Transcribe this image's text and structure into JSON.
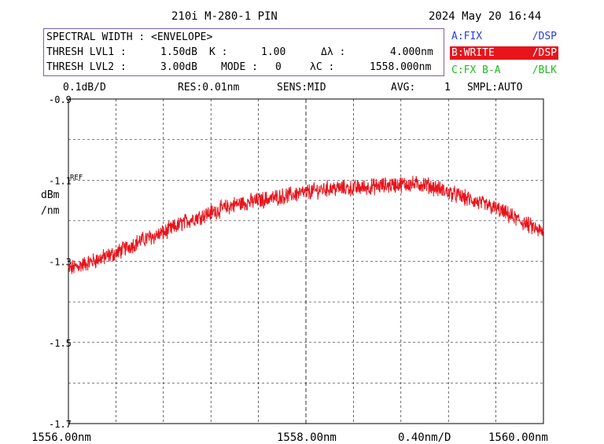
{
  "header": {
    "title": "210i M-280-1 PIN",
    "datetime": "2024 May 20 16:44"
  },
  "params": {
    "line1_label": "SPECTRAL WIDTH : <ENVELOPE>",
    "thresh1_label": "THRESH LVL1 :",
    "thresh1_value": "1.50dB",
    "k_label": "K :",
    "k_value": "1.00",
    "dlambda_label": "Δλ :",
    "dlambda_value": "4.000nm",
    "thresh2_label": "THRESH LVL2 :",
    "thresh2_value": "3.00dB",
    "mode_label": "MODE :",
    "mode_value": "0",
    "lambdac_label": "λC :",
    "lambdac_value": "1558.000nm"
  },
  "traces": [
    {
      "left": "A:FIX",
      "right": "/DSP",
      "color": "#2a3fd0",
      "bg": "#ffffff"
    },
    {
      "left": "B:WRITE",
      "right": "/DSP",
      "color": "#ffffff",
      "bg": "#e8141c"
    },
    {
      "left": "C:FX B-A",
      "right": "/BLK",
      "color": "#22bb22",
      "bg": "#ffffff"
    }
  ],
  "status": {
    "scale": "0.1dB/D",
    "res": "RES:0.01nm",
    "sens": "SENS:MID",
    "avg_label": "AVG:",
    "avg_value": "1",
    "smpl": "SMPL:AUTO"
  },
  "chart_data": {
    "type": "line",
    "ylim": [
      -1.7,
      -0.9
    ],
    "xlim": [
      1556.0,
      1560.0
    ],
    "y_ticks": [
      "-0.9",
      "-1.1",
      "-1.3",
      "-1.5",
      "-1.7"
    ],
    "y_unit_1": "dBm",
    "y_unit_2": "/nm",
    "ref_label": "REF",
    "ref_value": -1.1,
    "x_start_label": "1556.00nm",
    "x_center_label": "1558.00nm",
    "x_span_label": "0.40nm/D",
    "x_end_label": "1560.00nm",
    "trace_color": "#e8141c",
    "series": [
      {
        "x": [
          1556.0,
          1556.2,
          1556.4,
          1556.6,
          1556.8,
          1557.0,
          1557.2,
          1557.4,
          1557.6,
          1557.8,
          1558.0,
          1558.2,
          1558.4,
          1558.6,
          1558.8,
          1559.0,
          1559.2,
          1559.4,
          1559.6,
          1559.8,
          1560.0
        ],
        "y": [
          -1.32,
          -1.3,
          -1.28,
          -1.25,
          -1.23,
          -1.2,
          -1.18,
          -1.16,
          -1.15,
          -1.14,
          -1.13,
          -1.12,
          -1.12,
          -1.115,
          -1.11,
          -1.11,
          -1.13,
          -1.15,
          -1.17,
          -1.2,
          -1.23
        ]
      }
    ]
  }
}
